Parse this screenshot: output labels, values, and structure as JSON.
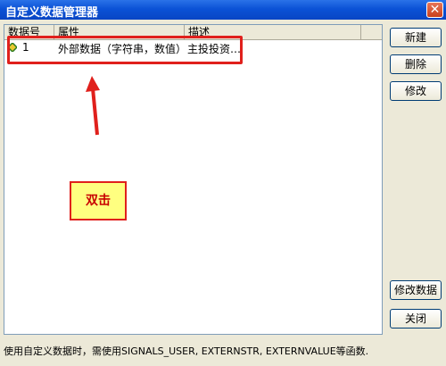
{
  "window": {
    "title": "自定义数据管理器",
    "close_glyph": "✕"
  },
  "list": {
    "columns": [
      "数据号",
      "属性",
      "描述"
    ],
    "rows": [
      {
        "id": "1",
        "attribute": "外部数据（字符串，数值）",
        "description": "主投投资…"
      }
    ]
  },
  "annotation": {
    "callout_text": "双击"
  },
  "buttons": {
    "new": "新建",
    "delete": "删除",
    "modify": "修改",
    "modify_data": "修改数据",
    "close": "关闭"
  },
  "status": {
    "text": "使用自定义数据时，需使用SIGNALS_USER, EXTERNSTR, EXTERNVALUE等函数."
  },
  "colors": {
    "annotation_red": "#e0201c",
    "titlebar_blue": "#0b52d6"
  }
}
